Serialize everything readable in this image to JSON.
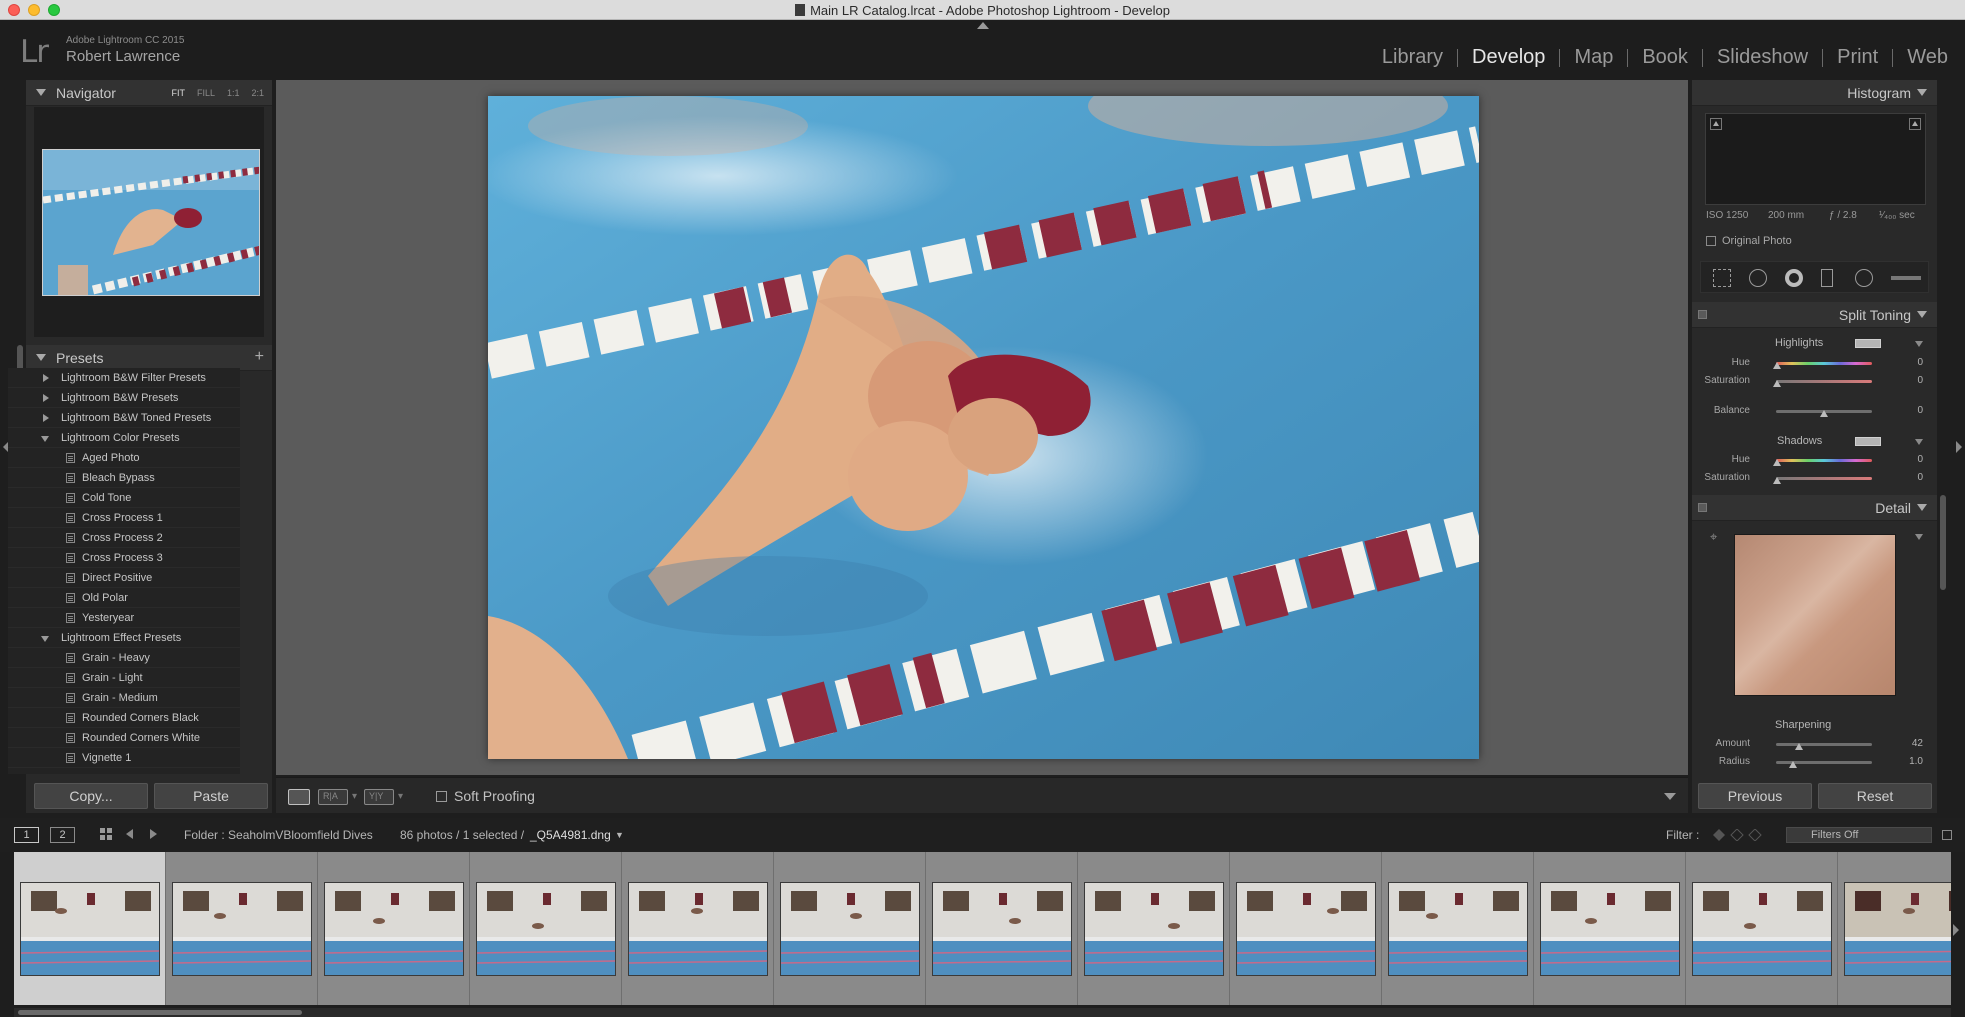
{
  "window": {
    "title": "Main LR Catalog.lrcat - Adobe Photoshop Lightroom - Develop"
  },
  "identity": {
    "logo": "Lr",
    "app_name": "Adobe Lightroom CC 2015",
    "user_name": "Robert Lawrence"
  },
  "modules": [
    {
      "label": "Library",
      "active": false
    },
    {
      "label": "Develop",
      "active": true
    },
    {
      "label": "Map",
      "active": false
    },
    {
      "label": "Book",
      "active": false
    },
    {
      "label": "Slideshow",
      "active": false
    },
    {
      "label": "Print",
      "active": false
    },
    {
      "label": "Web",
      "active": false
    }
  ],
  "navigator": {
    "title": "Navigator",
    "zoom_options": [
      "FIT",
      "FILL",
      "1:1",
      "2:1"
    ],
    "active_zoom": "FIT"
  },
  "presets": {
    "title": "Presets",
    "add_symbol": "+",
    "items": [
      {
        "type": "folder",
        "label": "Lightroom B&W Filter Presets",
        "open": false
      },
      {
        "type": "folder",
        "label": "Lightroom B&W Presets",
        "open": false
      },
      {
        "type": "folder",
        "label": "Lightroom B&W Toned Presets",
        "open": false
      },
      {
        "type": "folder",
        "label": "Lightroom Color Presets",
        "open": true
      },
      {
        "type": "preset",
        "label": "Aged Photo"
      },
      {
        "type": "preset",
        "label": "Bleach Bypass"
      },
      {
        "type": "preset",
        "label": "Cold Tone"
      },
      {
        "type": "preset",
        "label": "Cross Process 1"
      },
      {
        "type": "preset",
        "label": "Cross Process 2"
      },
      {
        "type": "preset",
        "label": "Cross Process 3"
      },
      {
        "type": "preset",
        "label": "Direct Positive"
      },
      {
        "type": "preset",
        "label": "Old Polar"
      },
      {
        "type": "preset",
        "label": "Yesteryear"
      },
      {
        "type": "folder",
        "label": "Lightroom Effect Presets",
        "open": true
      },
      {
        "type": "preset",
        "label": "Grain - Heavy"
      },
      {
        "type": "preset",
        "label": "Grain - Light"
      },
      {
        "type": "preset",
        "label": "Grain - Medium"
      },
      {
        "type": "preset",
        "label": "Rounded Corners Black"
      },
      {
        "type": "preset",
        "label": "Rounded Corners White"
      },
      {
        "type": "preset",
        "label": "Vignette 1"
      }
    ]
  },
  "left_buttons": {
    "copy": "Copy...",
    "paste": "Paste"
  },
  "toolbar": {
    "compare_1": "R|A",
    "compare_2": "Y|Y",
    "soft_proofing": "Soft Proofing"
  },
  "histogram": {
    "title": "Histogram",
    "iso": "ISO 1250",
    "focal": "200 mm",
    "aperture": "ƒ / 2.8",
    "shutter": "¹⁄₄₀₀ sec",
    "original_photo": "Original Photo"
  },
  "split_toning": {
    "title": "Split Toning",
    "highlights_label": "Highlights",
    "shadows_label": "Shadows",
    "hue_label": "Hue",
    "saturation_label": "Saturation",
    "balance_label": "Balance",
    "highlights_hue": "0",
    "highlights_saturation": "0",
    "balance": "0",
    "shadows_hue": "0",
    "shadows_saturation": "0"
  },
  "detail": {
    "title": "Detail",
    "sharpening_label": "Sharpening",
    "amount_label": "Amount",
    "amount": "42",
    "radius_label": "Radius",
    "radius": "1.0"
  },
  "right_buttons": {
    "previous": "Previous",
    "reset": "Reset"
  },
  "filmstrip_bar": {
    "screen_1": "1",
    "screen_2": "2",
    "source": "Folder : SeaholmVBloomfield Dives",
    "count": "86 photos / 1 selected /",
    "filename": "_Q5A4981.dng",
    "filter_label": "Filter :",
    "filter_value": "Filters Off"
  },
  "filmstrip": {
    "visible_thumbs": 13,
    "selected_index": 0
  },
  "colors": {
    "pool_blue": "#4e9bc8",
    "lane_red": "#8e2b3f",
    "lane_white": "#eeeeea",
    "panel_bg": "#292929",
    "center_bg": "#5b5b5b"
  }
}
